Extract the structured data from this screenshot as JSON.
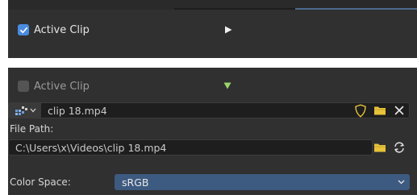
{
  "top_panel": {
    "checkbox_checked": true,
    "label": "Active Clip"
  },
  "bottom_panel": {
    "active_clip": {
      "checkbox_checked": false,
      "label": "Active Clip"
    },
    "clip_selector": {
      "value": "clip 18.mp4"
    },
    "file_path": {
      "label": "File Path:",
      "value": "C:\\Users\\x\\Videos\\clip 18.mp4"
    },
    "color_space": {
      "label": "Color Space:",
      "value": "sRGB"
    }
  },
  "colors": {
    "panel_bg": "#303030",
    "field_bg": "#1e1e1e",
    "accent_blue": "#4a8be0",
    "select_bg": "#3d5a80",
    "folder_yellow": "#e8c33a",
    "expand_green": "#9ad46a"
  },
  "icons": [
    "checkmark-icon",
    "play-triangle-icon",
    "expand-triangle-icon",
    "clip-browse-icon",
    "chevron-down-icon",
    "fake-user-shield-icon",
    "folder-icon",
    "close-icon",
    "reload-icon"
  ]
}
